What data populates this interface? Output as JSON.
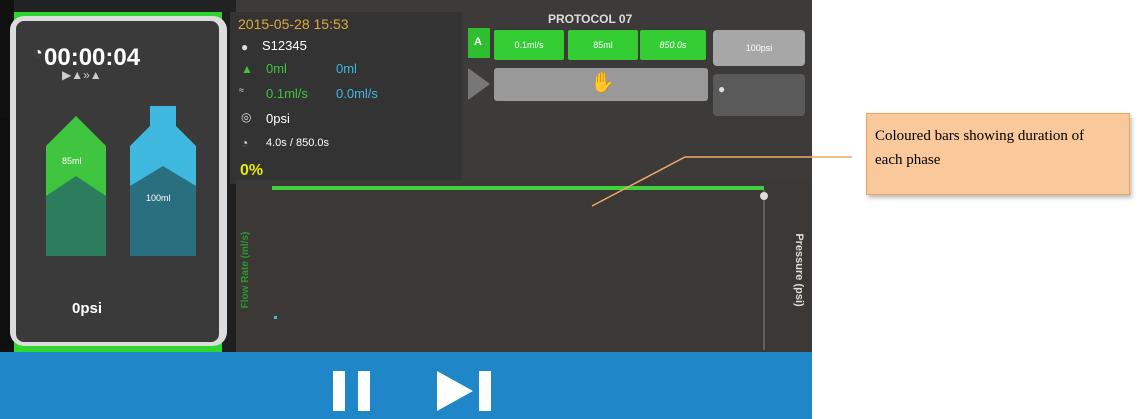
{
  "status": {
    "elapsed_time": "00:00:04",
    "bottle_a": {
      "volume_label": "85ml",
      "fill_fraction": 0.85,
      "color": "#3fc53f"
    },
    "bottle_b": {
      "volume_label": "100ml",
      "fill_fraction": 1.0,
      "color": "#3fb8df"
    },
    "pressure": "0psi"
  },
  "info": {
    "datetime": "2015-05-28 15:53",
    "patient_id": "S12345",
    "volume_a": "0ml",
    "volume_b": "0ml",
    "max_flow_a": "0.1ml/s",
    "max_flow_b": "0.0ml/s",
    "max_pressure": "0psi",
    "time_progress": "4.0s / 850.0s",
    "percent": "0%"
  },
  "protocol": {
    "title": "PROTOCOL 07",
    "phase_a": {
      "label": "A",
      "flow_rate": "0.1ml/s",
      "volume": "85ml",
      "duration": "850.0s"
    },
    "pressure_limit": "100psi"
  },
  "chart_data": {
    "type": "line",
    "ylabel": "Flow Rate (ml/s)",
    "y2label": "Pressure (psi)",
    "series": [],
    "phase_bar_color": "#3ed03e",
    "grid": false
  },
  "annotation": {
    "text": "Coloured bars showing duration of each phase"
  },
  "colors": {
    "accent_green": "#33cc33",
    "accent_blue": "#1f86c8",
    "date_orange": "#e2a83a",
    "percent_yellow": "#e8e800"
  },
  "icons": [
    "clock-icon",
    "syringe-icon",
    "flow-icon",
    "pressure-icon",
    "hand-icon",
    "pause-icon",
    "skip-next-icon"
  ]
}
